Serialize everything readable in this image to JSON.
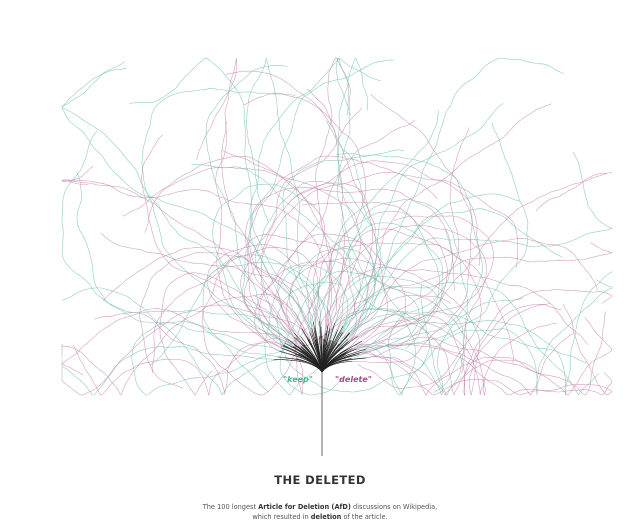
{
  "title": "THE DELETED",
  "caption": {
    "line1_pre": "The 100 longest ",
    "line1_bold": "Article for Deletion (AfD)",
    "line1_post": " discussions on Wikipedia,",
    "line2_pre": "which resulted in ",
    "line2_bold": "deletion",
    "line2_post": " of the article."
  },
  "legend": {
    "keep": {
      "label": "\"keep\"",
      "color": "#4fae92"
    },
    "delete": {
      "label": "\"delete\"",
      "color": "#a04d86"
    }
  },
  "colors": {
    "trunk": "#222222",
    "keep_line": "#6fc2ad",
    "delete_line": "#c987b3",
    "stem": "#444444"
  },
  "chart_data": {
    "type": "branching-tree",
    "discussion_count": 100,
    "vote_directions": {
      "keep": "left",
      "delete": "right"
    }
  }
}
